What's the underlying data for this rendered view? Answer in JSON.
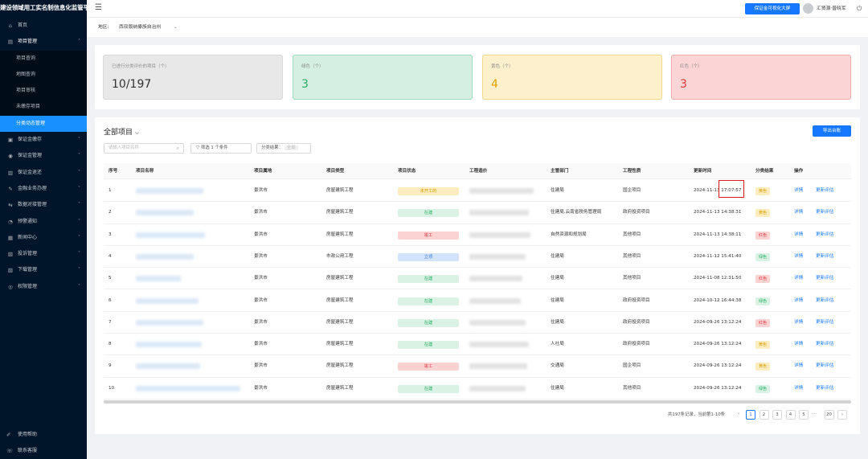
{
  "app": {
    "title": "建设领域用工实名制信息化监管平台"
  },
  "sidebar": {
    "items": [
      {
        "label": "首页",
        "icon": "home-icon",
        "glyph": "⌂",
        "has_children": false
      },
      {
        "label": "项目管理",
        "icon": "project-icon",
        "glyph": "▤",
        "has_children": true,
        "expanded": true,
        "children": [
          {
            "label": "项目查询",
            "active": false
          },
          {
            "label": "地图查询",
            "active": false
          },
          {
            "label": "项目审核",
            "active": false
          },
          {
            "label": "未缴存项目",
            "active": false
          },
          {
            "label": "分类动态管理",
            "active": true
          }
        ]
      },
      {
        "label": "保证金缴存",
        "icon": "deposit-icon",
        "glyph": "▣",
        "has_children": true
      },
      {
        "label": "保证金管理",
        "icon": "deposit-manage-icon",
        "glyph": "◉",
        "has_children": true
      },
      {
        "label": "保证金退还",
        "icon": "refund-icon",
        "glyph": "▥",
        "has_children": true
      },
      {
        "label": "金融业务办理",
        "icon": "finance-icon",
        "glyph": "✎",
        "has_children": true
      },
      {
        "label": "数据对接管理",
        "icon": "data-link-icon",
        "glyph": "⇆",
        "has_children": true
      },
      {
        "label": "预警通知",
        "icon": "warning-icon",
        "glyph": "◔",
        "has_children": true
      },
      {
        "label": "新闻中心",
        "icon": "news-icon",
        "glyph": "▦",
        "has_children": true
      },
      {
        "label": "投诉管理",
        "icon": "complaint-icon",
        "glyph": "▧",
        "has_children": true
      },
      {
        "label": "下载管理",
        "icon": "download-icon",
        "glyph": "▨",
        "has_children": true
      },
      {
        "label": "权限管理",
        "icon": "permission-icon",
        "glyph": "◎",
        "has_children": true
      }
    ],
    "footer": [
      {
        "label": "使用帮助",
        "icon": "help-icon",
        "glyph": "✐"
      },
      {
        "label": "联系客服",
        "icon": "service-icon",
        "glyph": "☏"
      }
    ]
  },
  "topbar": {
    "screen_button": "保证金可视化大屏",
    "username": "汇贤源·普晓军"
  },
  "filter": {
    "region_label": "地区:",
    "region_value": "西双版纳傣族自治州"
  },
  "summary": [
    {
      "title": "已进行分类评价的项目（个）",
      "value": "10/197"
    },
    {
      "title": "绿色（个）",
      "value": "3"
    },
    {
      "title": "黄色（个）",
      "value": "4"
    },
    {
      "title": "红色（个）",
      "value": "3"
    }
  ],
  "projects": {
    "title": "全部项目",
    "export_button": "导出台账",
    "search_placeholder": "请输入项目名称",
    "filter_button": "筛选 1 个条件",
    "result_label": "分类结果：",
    "result_placeholder": "全部",
    "columns": [
      "序号",
      "项目名称",
      "项目属地",
      "项目类型",
      "项目状态",
      "工程造价",
      "主管部门",
      "工程性质",
      "更新时间",
      "分类结果",
      "操作"
    ],
    "rows": [
      {
        "no": "1",
        "locale": "景洪市",
        "type": "房屋建筑工程",
        "status": "未开工的",
        "status_color": "yellow",
        "dept": "住建局",
        "nature": "国企项目",
        "updated": "2024-11-13 17:07:57",
        "result": "黄色",
        "result_color": "yellow"
      },
      {
        "no": "2",
        "locale": "景洪市",
        "type": "房屋建筑工程",
        "status": "在建",
        "status_color": "green",
        "dept": "住建局,云南省税务管理局",
        "nature": "政府投资项目",
        "updated": "2024-11-13 14:38:31",
        "result": "黄色",
        "result_color": "yellow"
      },
      {
        "no": "3",
        "locale": "景洪市",
        "type": "房屋建筑工程",
        "status": "竣工",
        "status_color": "red",
        "dept": "自然资源和规划局",
        "nature": "其他项目",
        "updated": "2024-11-13 14:38:11",
        "result": "红色",
        "result_color": "red"
      },
      {
        "no": "4",
        "locale": "景洪市",
        "type": "市政公用工程",
        "status": "立项",
        "status_color": "blue",
        "dept": "住建局",
        "nature": "其他项目",
        "updated": "2024-11-12 15:41:40",
        "result": "绿色",
        "result_color": "green"
      },
      {
        "no": "5",
        "locale": "景洪市",
        "type": "房屋建筑工程",
        "status": "在建",
        "status_color": "green",
        "dept": "住建局",
        "nature": "其他项目",
        "updated": "2024-11-08 12:31:50",
        "result": "红色",
        "result_color": "red"
      },
      {
        "no": "6",
        "locale": "景洪市",
        "type": "房屋建筑工程",
        "status": "在建",
        "status_color": "green",
        "dept": "住建局",
        "nature": "政府投资项目",
        "updated": "2024-10-12 16:44:38",
        "result": "绿色",
        "result_color": "green"
      },
      {
        "no": "7",
        "locale": "景洪市",
        "type": "房屋建筑工程",
        "status": "在建",
        "status_color": "green",
        "dept": "住建局",
        "nature": "政府投资项目",
        "updated": "2024-09-26 13:12:24",
        "result": "红色",
        "result_color": "red"
      },
      {
        "no": "8",
        "locale": "景洪市",
        "type": "房屋建筑工程",
        "status": "在建",
        "status_color": "green",
        "dept": "人社局",
        "nature": "政府投资项目",
        "updated": "2024-09-26 13:12:24",
        "result": "黄色",
        "result_color": "yellow"
      },
      {
        "no": "9",
        "locale": "景洪市",
        "type": "房屋建筑工程",
        "status": "竣工",
        "status_color": "red",
        "dept": "交通局",
        "nature": "国企项目",
        "updated": "2024-09-26 13:12:24",
        "result": "黄色",
        "result_color": "yellow"
      },
      {
        "no": "10",
        "locale": "景洪市",
        "type": "房屋建筑工程",
        "status": "在建",
        "status_color": "green",
        "dept": "住建局",
        "nature": "其他项目",
        "updated": "2024-09-26 13:12:24",
        "result": "绿色",
        "result_color": "green"
      }
    ],
    "action_detail": "详情",
    "action_update": "更新评估"
  },
  "pagination": {
    "info": "共197条记录，当前第1-10条",
    "pages": [
      "1",
      "2",
      "3",
      "4",
      "5",
      "20"
    ],
    "current": "1",
    "prev": "‹",
    "next": "›",
    "ellipsis": "···"
  },
  "colors": {
    "primary": "#1677ff",
    "sidebar_bg": "#001529",
    "highlight_box": "#d81e1e"
  }
}
